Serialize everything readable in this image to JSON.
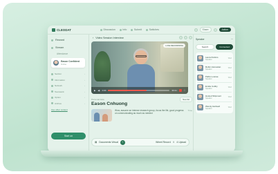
{
  "topbar": {
    "brand": "CLEODAT",
    "nav": [
      "Discussion",
      "Info",
      "Submit",
      "Switches"
    ],
    "right_button": "Share",
    "right_dark_button": "Action"
  },
  "sidebar": {
    "items": [
      "Reward",
      "Stream"
    ],
    "sub": "Attendance",
    "card_name": "Eason Confident",
    "card_sub": "Online",
    "mini_rows": [
      "Section",
      "Information",
      "Network",
      "Teamwork",
      "Option",
      "Archive"
    ],
    "link": "Use other content",
    "button": "Start on"
  },
  "main": {
    "title": "Video Session Interview",
    "live_label": "LIVE RECORDING",
    "time_current": "0:00",
    "time_total": "36:31",
    "progress": 0.62,
    "small_label": "Personal data",
    "name": "Eason Cnhuong",
    "tag": "See list",
    "description": "Wow, assume an intense research group, focus the life, good progress on communicating as much as needed",
    "time": "Time",
    "action_left": "Documents Virtual",
    "action_mid": "Wheel Record",
    "action_right": "4 Upload",
    "action_icon": "+"
  },
  "rpanel": {
    "title": "Speaker",
    "btn_light": "Search",
    "btn_dark": "Connected",
    "items": [
      {
        "name": "Laura Perkins",
        "sub": "Speaker",
        "r": "Wed"
      },
      {
        "name": "Robin Homestan",
        "sub": "Speaker",
        "r": "Wed"
      },
      {
        "name": "Pablo Loonae",
        "sub": "Speaker",
        "r": "Wed"
      },
      {
        "name": "Emilie Cottby",
        "sub": "Speaker",
        "r": "Wed"
      },
      {
        "name": "Hosted Shipment",
        "sub": "Speaker",
        "r": "Wed"
      },
      {
        "name": "Wendy Hartwell",
        "sub": "Speaker",
        "r": "Wed"
      }
    ]
  }
}
